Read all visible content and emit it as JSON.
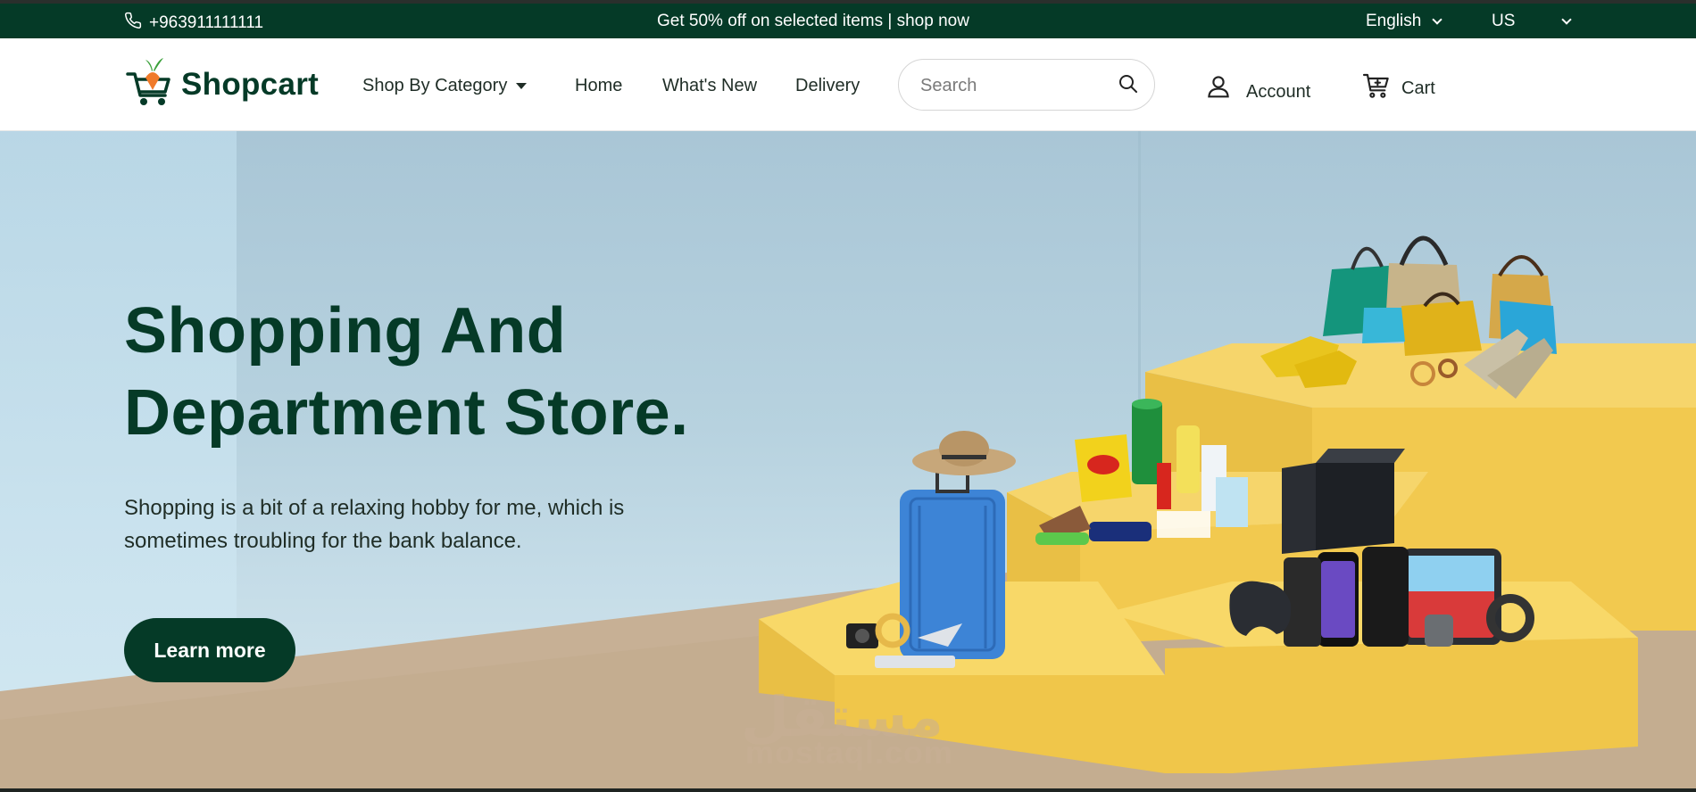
{
  "topbar": {
    "phone": "+963911111111",
    "promo": "Get 50% off on selected items | shop now",
    "language": "English",
    "region": "US"
  },
  "header": {
    "brand": "Shopcart",
    "category_menu": "Shop By Category",
    "nav": [
      "Home",
      "What's New",
      "Delivery"
    ],
    "search_placeholder": "Search",
    "account_label": "Account",
    "cart_label": "Cart"
  },
  "hero": {
    "title_line1": "Shopping And",
    "title_line2": "Department Store.",
    "description": "Shopping is a bit of a relaxing hobby for me, which is sometimes troubling for the bank balance.",
    "cta_label": "Learn more"
  },
  "watermark": {
    "arabic": "مستقل",
    "latin": "mostaql.com"
  },
  "colors": {
    "brand_dark_green": "#053a27",
    "brand_orange": "#f07a2a",
    "brand_leaf_green": "#3aa03a",
    "podium_yellow": "#f3cf5c"
  }
}
